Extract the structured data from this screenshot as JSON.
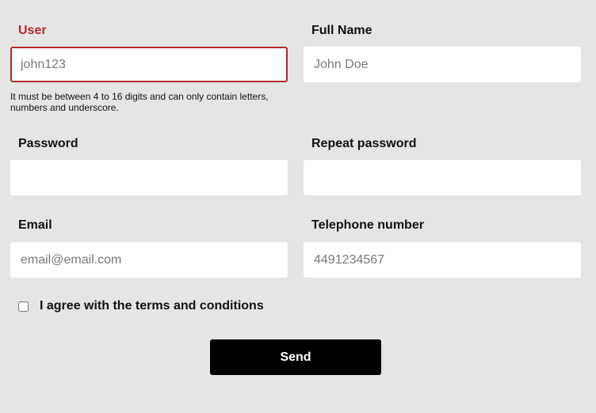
{
  "fields": {
    "user": {
      "label": "User",
      "placeholder": "john123",
      "value": "",
      "hint": "It must be between 4 to 16 digits and can only contain letters, numbers and underscore."
    },
    "full_name": {
      "label": "Full Name",
      "placeholder": "John Doe",
      "value": ""
    },
    "password": {
      "label": "Password",
      "placeholder": "",
      "value": ""
    },
    "repeat_password": {
      "label": "Repeat password",
      "placeholder": "",
      "value": ""
    },
    "email": {
      "label": "Email",
      "placeholder": "email@email.com",
      "value": ""
    },
    "telephone": {
      "label": "Telephone number",
      "placeholder": "4491234567",
      "value": ""
    }
  },
  "terms": {
    "label": "I agree with the terms and conditions",
    "checked": false
  },
  "send_button": {
    "label": "Send"
  },
  "colors": {
    "error": "#b32a2a",
    "background": "#e5e5e5",
    "button": "#000000"
  }
}
